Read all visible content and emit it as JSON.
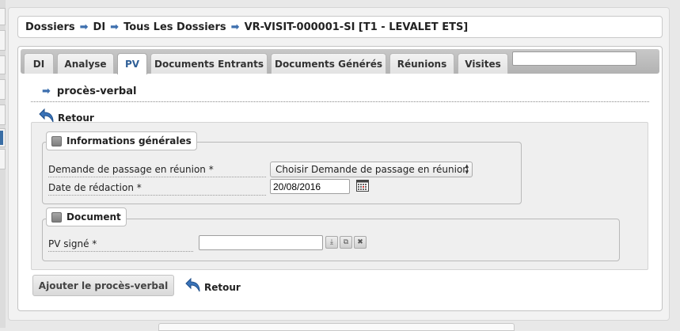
{
  "breadcrumb": {
    "items": [
      "Dossiers",
      "DI",
      "Tous Les Dossiers",
      "VR-VISIT-000001-SI [T1 - LEVALET ETS]"
    ],
    "separator_icon": "arrow-right-icon"
  },
  "tabs": [
    {
      "label": "DI"
    },
    {
      "label": "Analyse"
    },
    {
      "label": "PV",
      "active": true
    },
    {
      "label": "Documents Entrants"
    },
    {
      "label": "Documents Générés"
    },
    {
      "label": "Réunions"
    },
    {
      "label": "Visites"
    }
  ],
  "tab_search": {
    "value": ""
  },
  "section": {
    "title": "procès-verbal"
  },
  "retour_label": "Retour",
  "fieldset_general": {
    "legend": "Informations générales",
    "demande_label": "Demande de passage en réunion *",
    "demande_value": "Choisir Demande de passage en réunion",
    "date_label": "Date de rédaction *",
    "date_value": "20/08/2016"
  },
  "fieldset_document": {
    "legend": "Document",
    "pv_label": "PV signé *",
    "pv_value": ""
  },
  "submit_label": "Ajouter le procès-verbal",
  "colors": {
    "accent": "#3d6fae",
    "active_tab_text": "#2f5f97"
  }
}
